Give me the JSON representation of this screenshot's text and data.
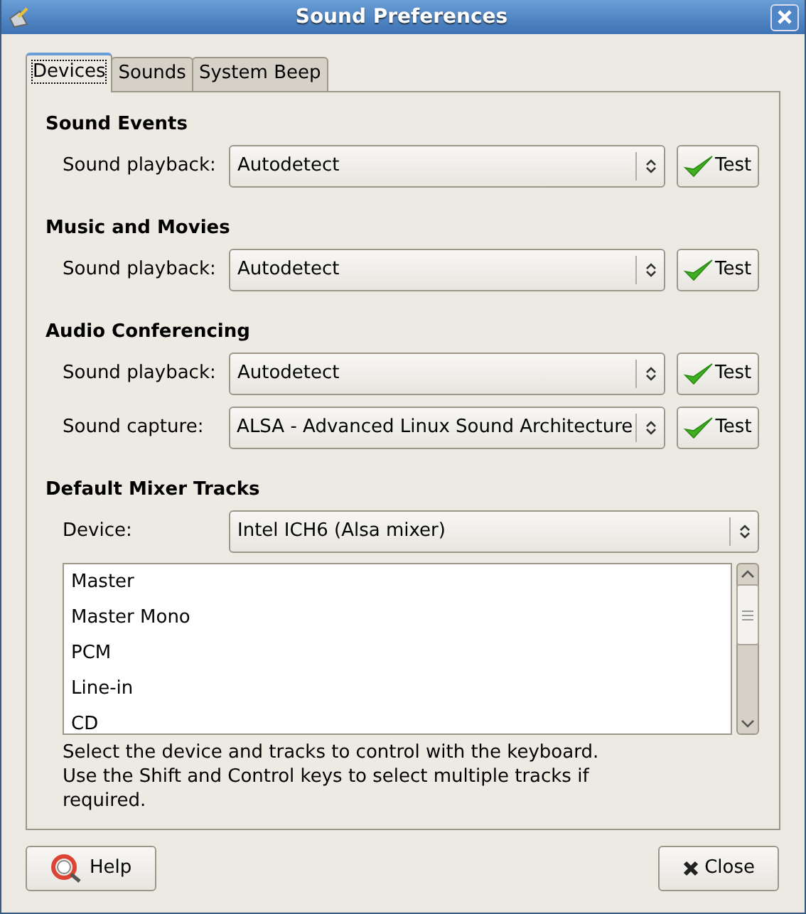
{
  "window": {
    "title": "Sound Preferences"
  },
  "tabs": [
    {
      "label": "Devices",
      "selected": true
    },
    {
      "label": "Sounds",
      "selected": false
    },
    {
      "label": "System Beep",
      "selected": false
    }
  ],
  "sections": [
    {
      "heading": "Sound Events",
      "rows": [
        {
          "label": "Sound playback:",
          "value": "Autodetect",
          "test": "Test"
        }
      ]
    },
    {
      "heading": "Music and Movies",
      "rows": [
        {
          "label": "Sound playback:",
          "value": "Autodetect",
          "test": "Test"
        }
      ]
    },
    {
      "heading": "Audio Conferencing",
      "rows": [
        {
          "label": "Sound playback:",
          "value": "Autodetect",
          "test": "Test"
        },
        {
          "label": "Sound capture:",
          "value": "ALSA - Advanced Linux Sound Architecture",
          "test": "Test"
        }
      ]
    }
  ],
  "mixer": {
    "heading": "Default Mixer Tracks",
    "device_label": "Device:",
    "device_value": "Intel ICH6 (Alsa mixer)",
    "tracks": [
      "Master",
      "Master Mono",
      "PCM",
      "Line-in",
      "CD"
    ],
    "hint": "Select the device and tracks to control with the keyboard.\nUse the Shift and Control keys to select multiple tracks if\nrequired."
  },
  "buttons": [
    {
      "label": "Help",
      "kind": "help"
    },
    {
      "label": "Close",
      "kind": "close"
    }
  ]
}
